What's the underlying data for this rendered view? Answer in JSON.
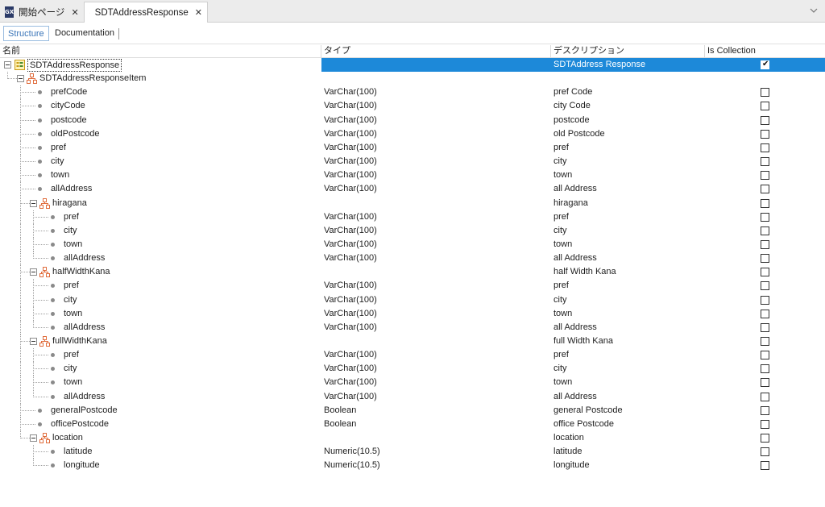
{
  "tabs": [
    {
      "label": "開始ページ",
      "icon": "gx-icon",
      "active": false
    },
    {
      "label": "SDTAddressResponse",
      "icon": "structure-icon",
      "active": true
    }
  ],
  "gx_icon_text": "GX",
  "subtabs": {
    "structure": "Structure",
    "documentation": "Documentation"
  },
  "columns": {
    "name": "名前",
    "type": "タイプ",
    "description": "デスクリプション",
    "collection": "Is Collection"
  },
  "colors": {
    "selection": "#1d89d9",
    "accent": "#3a75b8",
    "struct_icon": "#e06c3c"
  },
  "rows": [
    {
      "name": "SDTAddressResponse",
      "type": "",
      "description": "SDTAddress Response",
      "collection": true,
      "kind": "root",
      "level": 0,
      "selected": true
    },
    {
      "name": "SDTAddressResponseItem",
      "type": "",
      "description": "",
      "collection": null,
      "kind": "struct",
      "level": 1
    },
    {
      "name": "prefCode",
      "type": "VarChar(100)",
      "description": "pref Code",
      "collection": false,
      "kind": "leaf",
      "level": 2
    },
    {
      "name": "cityCode",
      "type": "VarChar(100)",
      "description": "city Code",
      "collection": false,
      "kind": "leaf",
      "level": 2
    },
    {
      "name": "postcode",
      "type": "VarChar(100)",
      "description": "postcode",
      "collection": false,
      "kind": "leaf",
      "level": 2
    },
    {
      "name": "oldPostcode",
      "type": "VarChar(100)",
      "description": "old Postcode",
      "collection": false,
      "kind": "leaf",
      "level": 2
    },
    {
      "name": "pref",
      "type": "VarChar(100)",
      "description": "pref",
      "collection": false,
      "kind": "leaf",
      "level": 2
    },
    {
      "name": "city",
      "type": "VarChar(100)",
      "description": "city",
      "collection": false,
      "kind": "leaf",
      "level": 2
    },
    {
      "name": "town",
      "type": "VarChar(100)",
      "description": "town",
      "collection": false,
      "kind": "leaf",
      "level": 2
    },
    {
      "name": "allAddress",
      "type": "VarChar(100)",
      "description": "all Address",
      "collection": false,
      "kind": "leaf",
      "level": 2
    },
    {
      "name": "hiragana",
      "type": "",
      "description": "hiragana",
      "collection": false,
      "kind": "struct",
      "level": 2
    },
    {
      "name": "pref",
      "type": "VarChar(100)",
      "description": "pref",
      "collection": false,
      "kind": "leaf",
      "level": 3
    },
    {
      "name": "city",
      "type": "VarChar(100)",
      "description": "city",
      "collection": false,
      "kind": "leaf",
      "level": 3
    },
    {
      "name": "town",
      "type": "VarChar(100)",
      "description": "town",
      "collection": false,
      "kind": "leaf",
      "level": 3
    },
    {
      "name": "allAddress",
      "type": "VarChar(100)",
      "description": "all Address",
      "collection": false,
      "kind": "leaf",
      "level": 3
    },
    {
      "name": "halfWidthKana",
      "type": "",
      "description": "half Width Kana",
      "collection": false,
      "kind": "struct",
      "level": 2
    },
    {
      "name": "pref",
      "type": "VarChar(100)",
      "description": "pref",
      "collection": false,
      "kind": "leaf",
      "level": 3
    },
    {
      "name": "city",
      "type": "VarChar(100)",
      "description": "city",
      "collection": false,
      "kind": "leaf",
      "level": 3
    },
    {
      "name": "town",
      "type": "VarChar(100)",
      "description": "town",
      "collection": false,
      "kind": "leaf",
      "level": 3
    },
    {
      "name": "allAddress",
      "type": "VarChar(100)",
      "description": "all Address",
      "collection": false,
      "kind": "leaf",
      "level": 3
    },
    {
      "name": "fullWidthKana",
      "type": "",
      "description": "full Width Kana",
      "collection": false,
      "kind": "struct",
      "level": 2
    },
    {
      "name": "pref",
      "type": "VarChar(100)",
      "description": "pref",
      "collection": false,
      "kind": "leaf",
      "level": 3
    },
    {
      "name": "city",
      "type": "VarChar(100)",
      "description": "city",
      "collection": false,
      "kind": "leaf",
      "level": 3
    },
    {
      "name": "town",
      "type": "VarChar(100)",
      "description": "town",
      "collection": false,
      "kind": "leaf",
      "level": 3
    },
    {
      "name": "allAddress",
      "type": "VarChar(100)",
      "description": "all Address",
      "collection": false,
      "kind": "leaf",
      "level": 3
    },
    {
      "name": "generalPostcode",
      "type": "Boolean",
      "description": "general Postcode",
      "collection": false,
      "kind": "leaf",
      "level": 2
    },
    {
      "name": "officePostcode",
      "type": "Boolean",
      "description": "office Postcode",
      "collection": false,
      "kind": "leaf",
      "level": 2
    },
    {
      "name": "location",
      "type": "",
      "description": "location",
      "collection": false,
      "kind": "struct",
      "level": 2
    },
    {
      "name": "latitude",
      "type": "Numeric(10.5)",
      "description": "latitude",
      "collection": false,
      "kind": "leaf",
      "level": 3
    },
    {
      "name": "longitude",
      "type": "Numeric(10.5)",
      "description": "longitude",
      "collection": false,
      "kind": "leaf",
      "level": 3
    }
  ]
}
